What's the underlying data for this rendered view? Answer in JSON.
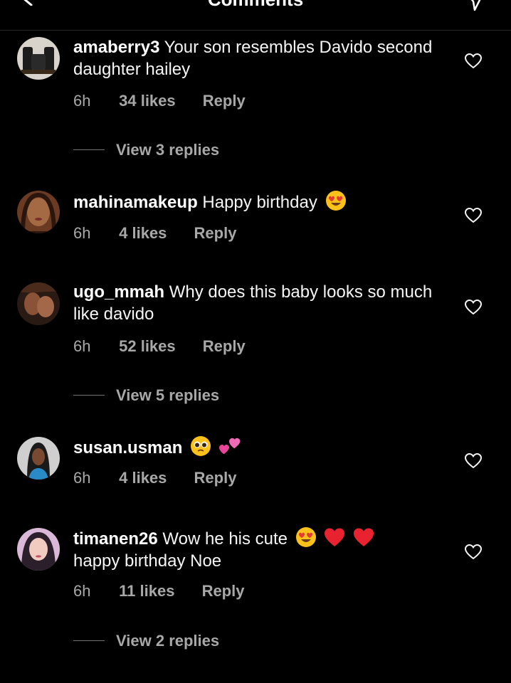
{
  "header": {
    "title": "Comments",
    "back_icon": "chevron-left-icon",
    "send_icon": "paper-plane-icon"
  },
  "comments": [
    {
      "username": "amaberry3",
      "text": "Your son resembles Davido second daughter hailey",
      "emojis": [],
      "time": "6h",
      "likes": "34 likes",
      "reply": "Reply",
      "view_replies": "View 3 replies"
    },
    {
      "username": "mahinamakeup",
      "text": "Happy birthday",
      "emojis": [
        "heart-eyes-emoji"
      ],
      "time": "6h",
      "likes": "4 likes",
      "reply": "Reply",
      "view_replies": null
    },
    {
      "username": "ugo_mmah",
      "text": "Why does this baby looks so much like davido",
      "emojis": [],
      "time": "6h",
      "likes": "52 likes",
      "reply": "Reply",
      "view_replies": "View 5 replies"
    },
    {
      "username": "susan.usman",
      "text": "",
      "emojis": [
        "pleading-face-emoji",
        "two-hearts-emoji"
      ],
      "time": "6h",
      "likes": "4 likes",
      "reply": "Reply",
      "view_replies": null
    },
    {
      "username": "timanen26",
      "text": "Wow he his cute",
      "text_after": "happy birthday Noe",
      "emojis": [
        "heart-eyes-emoji",
        "red-heart-emoji",
        "red-heart-emoji"
      ],
      "time": "6h",
      "likes": "11 likes",
      "reply": "Reply",
      "view_replies": "View 2 replies"
    }
  ],
  "colors": {
    "background": "#000000",
    "primary_text": "#f5f5f5",
    "secondary_text": "#a8a8a8",
    "divider": "#262626"
  }
}
